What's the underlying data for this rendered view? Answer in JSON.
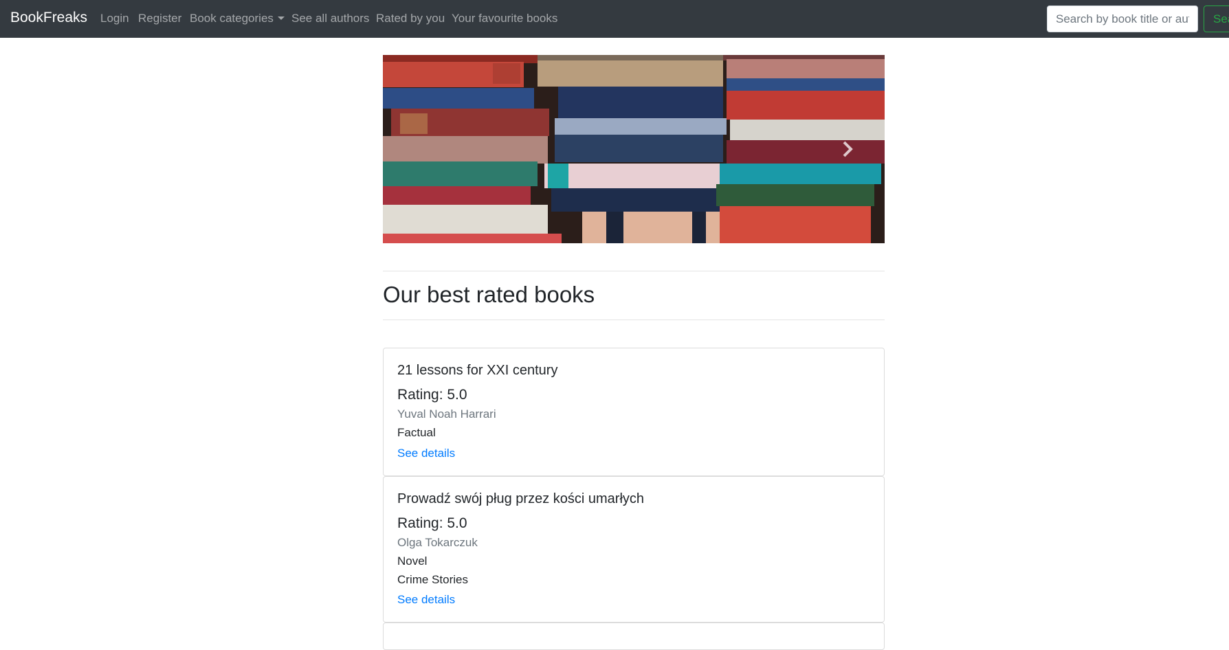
{
  "navbar": {
    "brand": "BookFreaks",
    "links": [
      "Login",
      "Register",
      "Book categories",
      "See all authors",
      "Rated by you",
      "Your favourite books"
    ],
    "search_placeholder": "Search by book title or author",
    "search_button": "Search"
  },
  "carousel": {
    "next_icon": "chevron-right-icon"
  },
  "section_title": "Our best rated books",
  "books": [
    {
      "title": "21 lessons for XXI century",
      "rating": "Rating: 5.0",
      "author": "Yuval Noah Harrari",
      "categories": [
        "Factual"
      ],
      "link": "See details"
    },
    {
      "title": "Prowadź swój pług przez kości umarłych",
      "rating": "Rating: 5.0",
      "author": "Olga Tokarczuk",
      "categories": [
        "Novel",
        "Crime Stories"
      ],
      "link": "See details"
    }
  ],
  "colors": {
    "navbar_bg": "#343a40",
    "link": "#007bff",
    "search_button": "#28a745"
  }
}
